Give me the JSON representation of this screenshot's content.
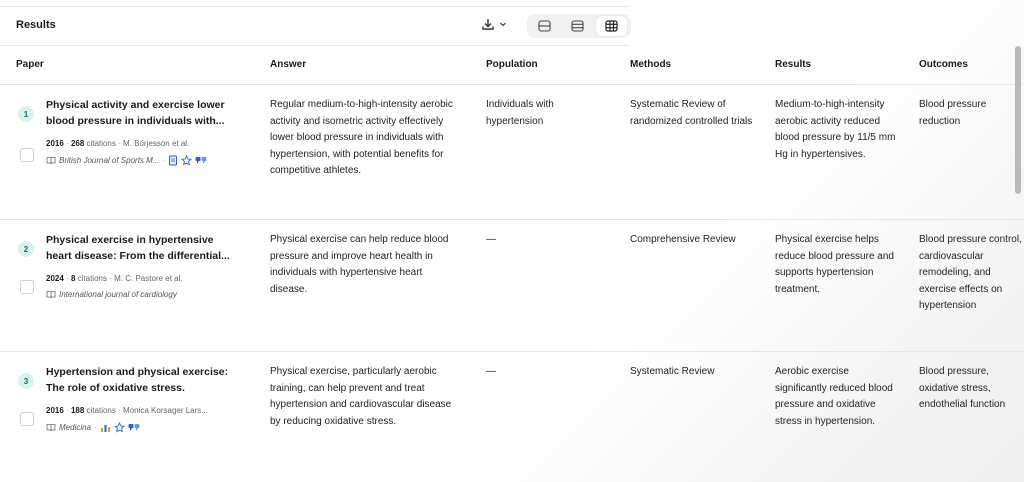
{
  "toolbar": {
    "title": "Results"
  },
  "columns": {
    "paper": "Paper",
    "answer": "Answer",
    "population": "Population",
    "methods": "Methods",
    "results": "Results",
    "outcomes": "Outcomes"
  },
  "rows": [
    {
      "num": "1",
      "title_line1": "Physical activity and exercise lower",
      "title_line2": "blood pressure in individuals with...",
      "year": "2016",
      "citations": "268",
      "citations_label": "citations",
      "authors": "M. Börjesson et al.",
      "journal": "British Journal of Sports M...",
      "answer": "Regular medium-to-high-intensity aerobic activity and isometric activity effectively lower blood pressure in individuals with hypertension, with potential benefits for competitive athletes.",
      "population": "Individuals with hypertension",
      "methods": "Systematic Review of randomized controlled trials",
      "results": "Medium-to-high-intensity aerobic activity reduced blood pressure by 11/5 mm Hg in hypertensives.",
      "outcomes": "Blood pressure reduction"
    },
    {
      "num": "2",
      "title_line1": "Physical exercise in hypertensive",
      "title_line2": "heart disease: From the differential...",
      "year": "2024",
      "citations": "8",
      "citations_label": "citations",
      "authors": "M. C. Pastore et al.",
      "journal": "International journal of cardiology",
      "answer": "Physical exercise can help reduce blood pressure and improve heart health in individuals with hypertensive heart disease.",
      "population": "—",
      "methods": "Comprehensive Review",
      "results": "Physical exercise helps reduce blood pressure and supports hypertension treatment.",
      "outcomes": "Blood pressure control, cardiovascular remodeling, and exercise effects on hypertension"
    },
    {
      "num": "3",
      "title_line1": "Hypertension and physical exercise:",
      "title_line2": "The role of oxidative stress.",
      "year": "2016",
      "citations": "188",
      "citations_label": "citations",
      "authors": "Monica Korsager Lars...",
      "journal": "Medicina",
      "answer": "Physical exercise, particularly aerobic training, can help prevent and treat hypertension and cardiovascular disease by reducing oxidative stress.",
      "population": "—",
      "methods": "Systematic Review",
      "results": "Aerobic exercise significantly reduced blood pressure and oxidative stress in hypertension.",
      "outcomes": "Blood pressure, oxidative stress, endothelial function"
    }
  ],
  "icons": {
    "download": "download-icon",
    "chevron": "chevron-down-icon",
    "view_cards": "view-cards-icon",
    "view_list": "view-list-icon",
    "view_table": "view-table-icon",
    "journal": "book-icon",
    "quality": "star-badge-icon",
    "doc": "document-icon",
    "bars": "bar-chart-icon",
    "chat": "chat-icon"
  },
  "colors": {
    "badge_bg": "#d9f3ec",
    "badge_text": "#1b6b56",
    "icon_blue": "#2f5fd0",
    "icon_gold": "#d7a21a"
  }
}
